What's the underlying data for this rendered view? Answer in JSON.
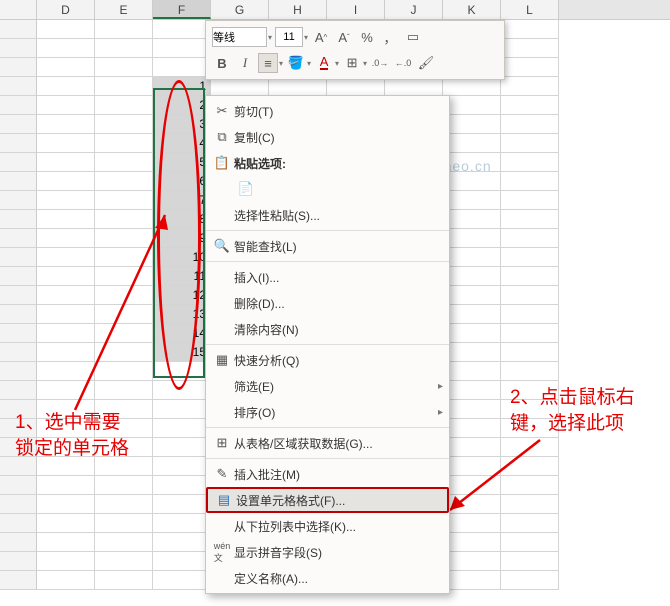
{
  "columns": [
    "D",
    "E",
    "F",
    "G",
    "H",
    "I",
    "J",
    "K",
    "L"
  ],
  "selected_col": "F",
  "cell_values": [
    "1",
    "2",
    "3",
    "4",
    "5",
    "6",
    "7",
    "8",
    "9",
    "10",
    "11",
    "12",
    "13",
    "14",
    "15"
  ],
  "watermark": "passneo.cn",
  "minitb": {
    "font": "等线",
    "size": "11",
    "icons_r1": [
      "A↑",
      "A↓",
      "%",
      "，",
      "fmt"
    ],
    "bold": "B",
    "italic": "I",
    "align": "≡",
    "fill": "◇",
    "fontcolor": "A",
    "border": "田",
    "indent": "⊞",
    "merge": "⊡",
    "brush": "✎"
  },
  "menu": {
    "cut": "剪切(T)",
    "copy": "复制(C)",
    "paste_opt": "粘贴选项:",
    "paste_icon": "",
    "paste_special": "选择性粘贴(S)...",
    "smart_lookup": "智能查找(L)",
    "insert": "插入(I)...",
    "delete": "删除(D)...",
    "clear": "清除内容(N)",
    "quick_analysis": "快速分析(Q)",
    "filter": "筛选(E)",
    "sort": "排序(O)",
    "from_table": "从表格/区域获取数据(G)...",
    "insert_comment": "插入批注(M)",
    "format_cells": "设置单元格格式(F)...",
    "from_dropdown": "从下拉列表中选择(K)...",
    "show_pinyin": "显示拼音字段(S)",
    "define_name": "定义名称(A)..."
  },
  "anno1": "1、选中需要\n锁定的单元格",
  "anno2": "2、点击鼠标右\n键，选择此项"
}
